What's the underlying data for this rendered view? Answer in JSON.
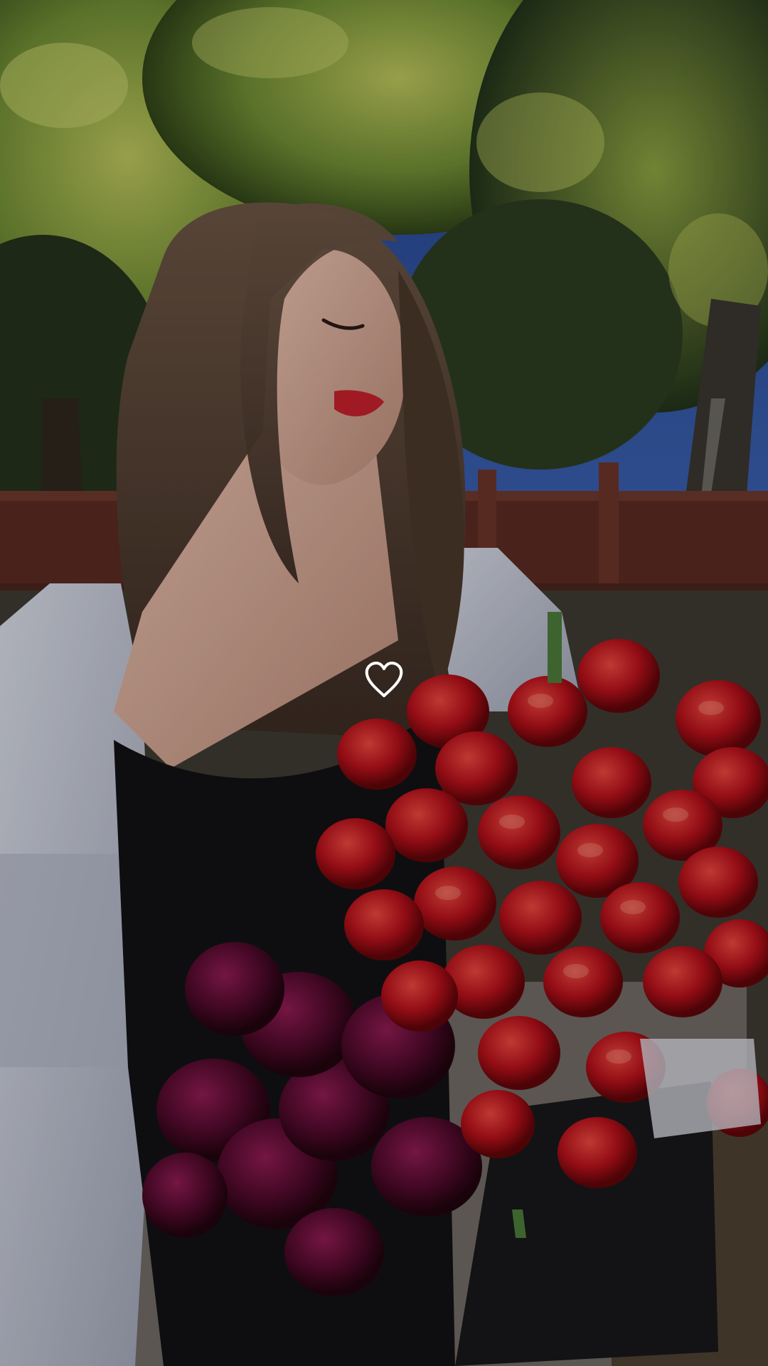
{
  "wallpaper": {
    "subject": "woman-with-tulip-bouquet",
    "colors": {
      "sky": "#2c4f9a",
      "foliage": "#5f7a2e",
      "foliage_light": "#a9b54a",
      "wall": "#5a2a22",
      "hair": "#5a4434",
      "skin": "#e2b6a4",
      "shirt": "#c7cad6",
      "top": "#121214",
      "tulip_red": "#c8141c",
      "tulip_purple": "#5c0d33",
      "pavement": "#6f6a65"
    }
  },
  "like": {
    "icon": "heart-outline-icon",
    "liked": false,
    "color": "#ffffff"
  }
}
